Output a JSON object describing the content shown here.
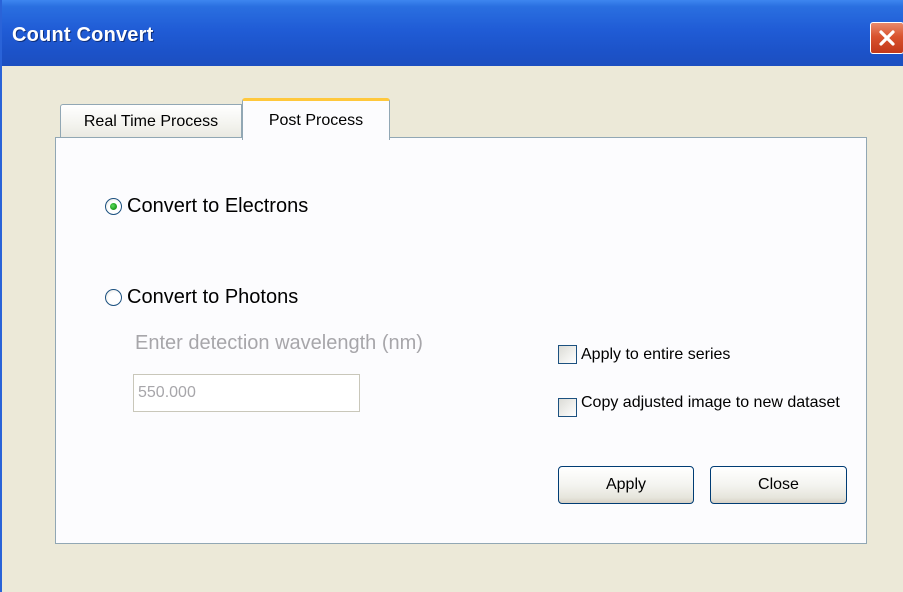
{
  "window": {
    "title": "Count Convert",
    "colors": {
      "titlebar": "#205cd6",
      "close_button": "#d9532f",
      "window_background": "#ece9d8",
      "panel_background": "#fcfcfe",
      "active_tab_highlight": "#ffc83c",
      "disabled_text": "#a7a6aa",
      "radio_selected_dot": "#21a121"
    }
  },
  "tabs": [
    {
      "label": "Real Time Process",
      "selected": false
    },
    {
      "label": "Post Process",
      "selected": true
    }
  ],
  "options": {
    "electrons": {
      "label": "Convert to Electrons",
      "selected": true
    },
    "photons": {
      "label": "Convert to Photons",
      "selected": false
    }
  },
  "wavelength": {
    "label": "Enter detection wavelength (nm)",
    "value": "550.000",
    "enabled": false
  },
  "checkboxes": {
    "apply_series": {
      "label": "Apply to entire series",
      "checked": false
    },
    "copy_image": {
      "label": "Copy adjusted image to new dataset",
      "checked": false
    }
  },
  "buttons": {
    "apply": "Apply",
    "close": "Close"
  },
  "icons": {
    "close": "close-x-icon"
  }
}
